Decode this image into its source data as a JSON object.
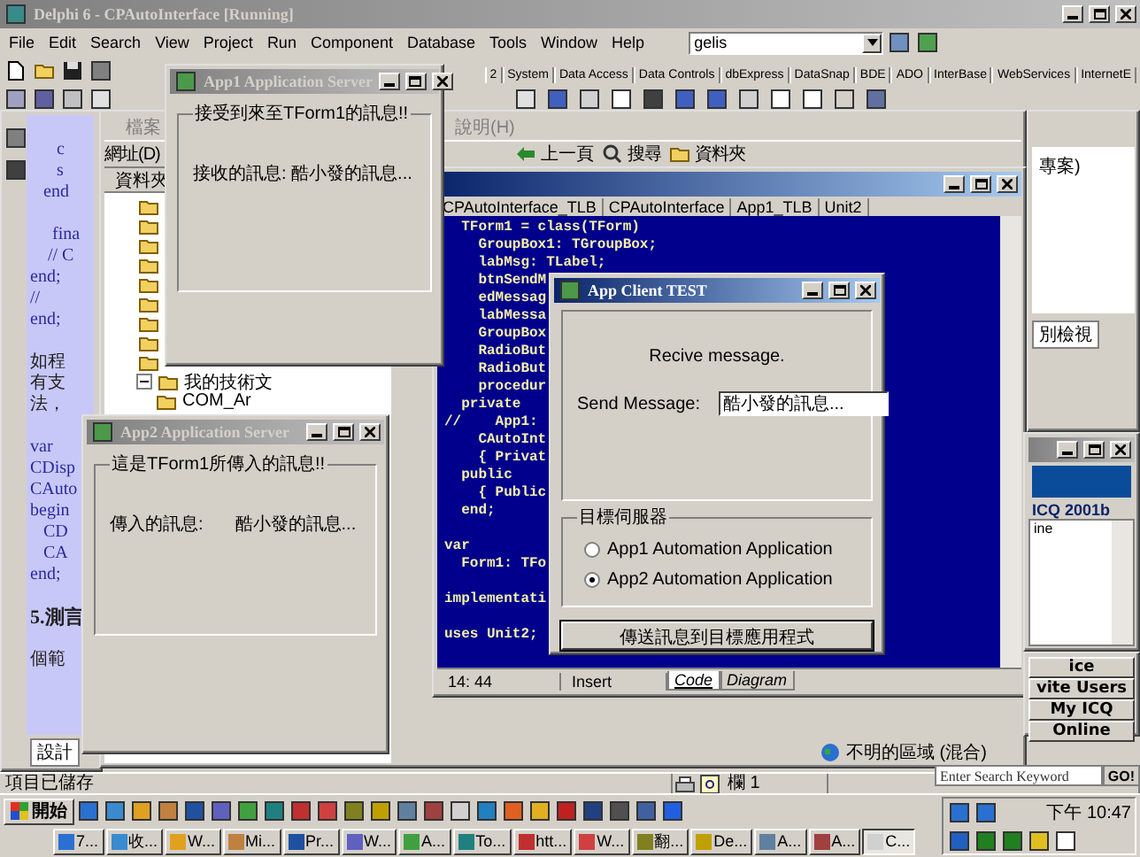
{
  "main_window": {
    "title": "Delphi 6 - CPAutoInterface [Running]",
    "active": false,
    "menu": [
      "File",
      "Edit",
      "Search",
      "View",
      "Project",
      "Run",
      "Component",
      "Database",
      "Tools",
      "Window",
      "Help"
    ],
    "desktop_combo": "gelis"
  },
  "component_palette": {
    "tabs": [
      {
        "label": "2",
        "selected": false
      },
      {
        "label": "System",
        "selected": false
      },
      {
        "label": "Data Access",
        "selected": false
      },
      {
        "label": "Data Controls",
        "selected": false
      },
      {
        "label": "dbExpress",
        "selected": false
      },
      {
        "label": "DataSnap",
        "selected": false
      },
      {
        "label": "BDE",
        "selected": false
      },
      {
        "label": "ADO",
        "selected": false
      },
      {
        "label": "InterBase",
        "selected": false
      },
      {
        "label": "WebServices",
        "selected": false
      },
      {
        "label": "InternetE",
        "selected": false
      }
    ]
  },
  "web_editor": {
    "lines": [
      {
        "text": "      c",
        "kind": "code",
        "blank_before": false
      },
      {
        "text": "      s",
        "kind": "code",
        "blank_before": false
      },
      {
        "text": "   end",
        "kind": "code",
        "blank_before": false
      },
      {
        "text": "     fina",
        "kind": "code",
        "blank_before": true
      },
      {
        "text": "    // C",
        "kind": "code",
        "blank_before": false
      },
      {
        "text": "end;",
        "kind": "code",
        "blank_before": false
      },
      {
        "text": "//",
        "kind": "code",
        "blank_before": false
      },
      {
        "text": "end;",
        "kind": "code",
        "blank_before": false
      },
      {
        "text": "如程",
        "kind": "text",
        "blank_before": true
      },
      {
        "text": "有支",
        "kind": "text",
        "blank_before": false
      },
      {
        "text": "法，",
        "kind": "text",
        "blank_before": false
      },
      {
        "text": "var",
        "kind": "code",
        "blank_before": true
      },
      {
        "text": "CDisp",
        "kind": "code",
        "blank_before": false
      },
      {
        "text": "CAuto",
        "kind": "code",
        "blank_before": false
      },
      {
        "text": "begin",
        "kind": "code",
        "blank_before": false
      },
      {
        "text": "   CD",
        "kind": "code",
        "blank_before": false
      },
      {
        "text": "   CA",
        "kind": "code",
        "blank_before": false
      },
      {
        "text": "end;",
        "kind": "code",
        "blank_before": false
      },
      {
        "text": "5.測言",
        "kind": "heading",
        "blank_before": true
      },
      {
        "text": "個範",
        "kind": "text",
        "blank_before": true
      }
    ],
    "design_tab": "設計"
  },
  "explorer": {
    "menu": [
      "檔案",
      "說明(H)"
    ],
    "address_label": "網址(D)",
    "toolbar": [
      "上一頁",
      "搜尋",
      "資料夾"
    ],
    "folders_header": "資料夾",
    "tree": [
      {
        "label": "我的技術文",
        "expanded": true,
        "children": [
          {
            "label": "COM_Ar"
          }
        ]
      }
    ],
    "zone": "不明的區域 (混合)"
  },
  "code_editor": {
    "active": true,
    "tabs": [
      {
        "label": "CPAutoInterface_TLB",
        "selected": false
      },
      {
        "label": "CPAutoInterface",
        "selected": false
      },
      {
        "label": "App1_TLB",
        "selected": false
      },
      {
        "label": "Unit2",
        "selected": false
      }
    ],
    "lines": [
      {
        "text": "  TForm1 = class(TForm)",
        "blank_before": false
      },
      {
        "text": "    GroupBox1: TGroupBox;",
        "blank_before": false
      },
      {
        "text": "    labMsg: TLabel;",
        "blank_before": false
      },
      {
        "text": "    btnSendM",
        "blank_before": false
      },
      {
        "text": "    edMessag",
        "blank_before": false
      },
      {
        "text": "    labMessa",
        "blank_before": false
      },
      {
        "text": "    GroupBox",
        "blank_before": false
      },
      {
        "text": "    RadioBut",
        "blank_before": false
      },
      {
        "text": "    RadioBut",
        "blank_before": false
      },
      {
        "text": "    procedur",
        "blank_before": false
      },
      {
        "text": "  private",
        "blank_before": false
      },
      {
        "text": "//    App1:",
        "blank_before": false
      },
      {
        "text": "    CAutoInt",
        "blank_before": false
      },
      {
        "text": "    { Privat",
        "blank_before": false
      },
      {
        "text": "  public",
        "blank_before": false
      },
      {
        "text": "    { Public",
        "blank_before": false
      },
      {
        "text": "  end;",
        "blank_before": false
      },
      {
        "text": "var",
        "blank_before": true
      },
      {
        "text": "  Form1: TFo",
        "blank_before": false
      },
      {
        "text": "implementati",
        "blank_before": true
      },
      {
        "text": "uses Unit2;",
        "blank_before": true
      }
    ],
    "position": "14: 44",
    "mode": "Insert",
    "view_tabs": [
      {
        "label": "Code",
        "selected": true
      },
      {
        "label": "Diagram",
        "selected": false
      }
    ]
  },
  "project_panel": {
    "item": "專案)",
    "tab": "別檢視"
  },
  "icq": {
    "version": "ICQ 2001b",
    "group": "ine",
    "buttons": [
      "ice",
      "vite Users",
      "My ICQ",
      "Online"
    ],
    "search_placeholder": "Enter Search Keyword",
    "go": "GO!"
  },
  "app1_window": {
    "title": "App1 Application Server",
    "active": false,
    "group_title": "接受到來至TForm1的訊息!!",
    "message": "接收的訊息: 酷小發的訊息..."
  },
  "app2_window": {
    "title": "App2 Application Server",
    "active": false,
    "group_title": "這是TForm1所傳入的訊息!!",
    "label": "傳入的訊息:",
    "value": "酷小發的訊息..."
  },
  "client_window": {
    "title": "App Client TEST",
    "active": true,
    "receive_label": "Recive message.",
    "send_label": "Send Message:",
    "send_value": "酷小發的訊息...",
    "target_group": "目標伺服器",
    "targets": [
      {
        "label": "App1 Automation Application",
        "selected": false
      },
      {
        "label": "App2 Automation Application",
        "selected": true
      }
    ],
    "send_button": "傳送訊息到目標應用程式"
  },
  "status_bar": {
    "message": "項目已儲存",
    "column": "欄 1"
  },
  "taskbar": {
    "start": "開始",
    "tasks": [
      {
        "label": "7...",
        "selected": false
      },
      {
        "label": "收...",
        "selected": false
      },
      {
        "label": "W...",
        "selected": false
      },
      {
        "label": "Mi...",
        "selected": false
      },
      {
        "label": "Pr...",
        "selected": false
      },
      {
        "label": "W...",
        "selected": false
      },
      {
        "label": "A...",
        "selected": false
      },
      {
        "label": "To...",
        "selected": false
      },
      {
        "label": "htt...",
        "selected": false
      },
      {
        "label": "W...",
        "selected": false
      },
      {
        "label": "翻...",
        "selected": false
      },
      {
        "label": "De...",
        "selected": false
      },
      {
        "label": "A...",
        "selected": false
      },
      {
        "label": "A...",
        "selected": false
      },
      {
        "label": "C...",
        "selected": true
      }
    ],
    "clock": "下午 10:47"
  }
}
